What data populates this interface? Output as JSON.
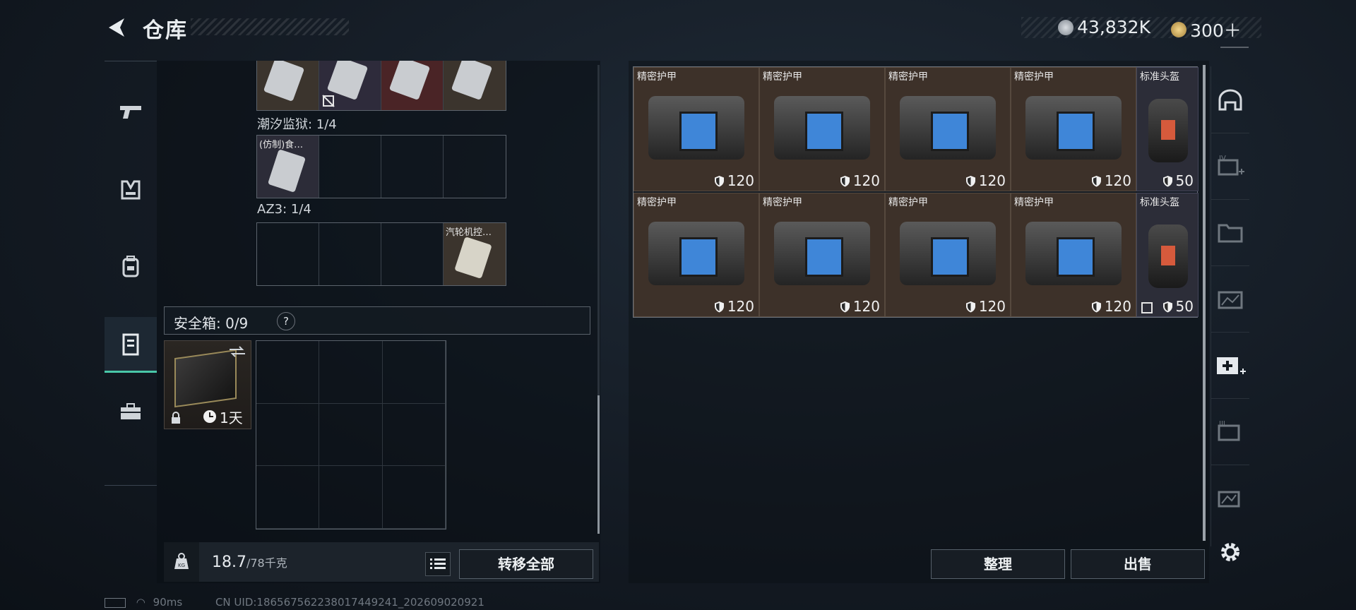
{
  "header": {
    "title": "仓库",
    "currency_silver": "43,832K",
    "currency_gold": "300＋"
  },
  "left_panel": {
    "sections": [
      {
        "label": "潮汐监狱: 1/4",
        "cells": [
          {
            "label": "(仿制)食…"
          },
          {
            "label": ""
          },
          {
            "label": ""
          },
          {
            "label": ""
          }
        ]
      },
      {
        "label": "AZ3: 1/4",
        "cells": [
          {
            "label": ""
          },
          {
            "label": ""
          },
          {
            "label": ""
          },
          {
            "label": "汽轮机控…"
          }
        ]
      }
    ],
    "safe_box": {
      "label": "安全箱: 0/9",
      "help": "?",
      "duration": "1天"
    },
    "weight": {
      "current": "18.7",
      "max": "/78千克"
    },
    "transfer_all": "转移全部"
  },
  "stash": {
    "items": [
      {
        "name": "精密护甲",
        "durability": "120",
        "type": "armor"
      },
      {
        "name": "精密护甲",
        "durability": "120",
        "type": "armor"
      },
      {
        "name": "精密护甲",
        "durability": "120",
        "type": "armor"
      },
      {
        "name": "精密护甲",
        "durability": "120",
        "type": "armor"
      },
      {
        "name": "标准头盔",
        "durability": "50",
        "type": "helmet"
      },
      {
        "name": "精密护甲",
        "durability": "120",
        "type": "armor"
      },
      {
        "name": "精密护甲",
        "durability": "120",
        "type": "armor"
      },
      {
        "name": "精密护甲",
        "durability": "120",
        "type": "armor"
      },
      {
        "name": "精密护甲",
        "durability": "120",
        "type": "armor"
      },
      {
        "name": "标准头盔",
        "durability": "50",
        "type": "helmet"
      }
    ],
    "sort_button": "整理",
    "sell_button": "出售"
  },
  "status_line": {
    "ping": "90ms",
    "uid": "CN UID:186567562238017449241_202609020921"
  },
  "colors": {
    "accent": "#49c7a8",
    "armor_bg": "#3d3129",
    "helmet_bg": "#2c2d38"
  },
  "icons": {
    "left_rail": [
      "gun-icon",
      "vest-icon",
      "backpack-icon",
      "container-icon",
      "toolbox-icon"
    ],
    "right_rail": [
      "helmet-tab-icon",
      "armor-tab-icon",
      "folder-tab-icon",
      "chart-tab-icon",
      "medkit-tab-icon",
      "item-tab-icon",
      "map-tab-icon"
    ]
  }
}
